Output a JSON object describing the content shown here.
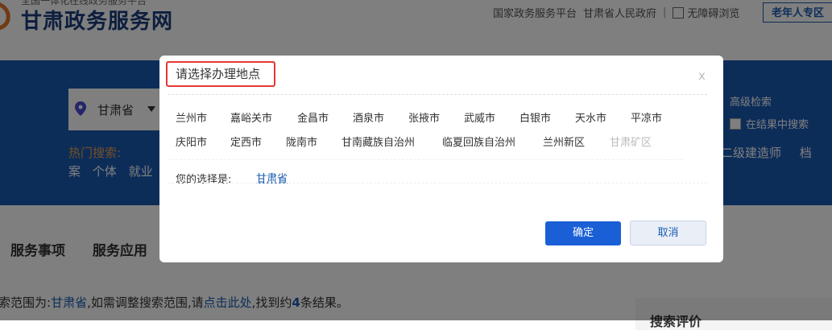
{
  "header": {
    "site_subtitle": "全国一体化在线政务服务平台",
    "site_title": "甘肃政务服务网",
    "links": [
      "国家政务服务平台",
      "甘肃省人民政府"
    ],
    "separator": "|",
    "accessibility": "无障碍浏览",
    "elder_zone": "老年人专区"
  },
  "banner": {
    "location": "甘肃省",
    "hot_label": "热门搜索:",
    "hot_row2": [
      "案",
      "个体",
      "就业"
    ],
    "advanced_search": "高级检索",
    "search_in_results": "在结果中搜索",
    "hot_right": [
      "二级建造师",
      "档"
    ]
  },
  "tabs": [
    "服务事项",
    "服务应用"
  ],
  "result": {
    "prefix": "索范围为:",
    "scope": "甘肃省",
    "middle": ",如需调整搜索范围,请",
    "link": "点击此处",
    "suffix1": ",找到约",
    "count": "4",
    "suffix2": "条结果。"
  },
  "side_panel": {
    "title": "搜索评价"
  },
  "modal": {
    "title": "请选择办理地点",
    "close": "x",
    "cities_row1": [
      "兰州市",
      "嘉峪关市",
      "金昌市",
      "酒泉市",
      "张掖市",
      "武威市",
      "白银市",
      "天水市",
      "平凉市"
    ],
    "cities_row2": [
      "庆阳市",
      "定西市",
      "陇南市",
      "甘南藏族自治州",
      "临夏回族自治州",
      "兰州新区"
    ],
    "disabled_city": "甘肃矿区",
    "choice_label": "您的选择是:",
    "choice_value": "甘肃省",
    "confirm": "确定",
    "cancel": "取消"
  },
  "colors": {
    "primary": "#1b5bb3",
    "accent_red": "#e53935",
    "hot_label": "#e8a14a",
    "confirm_button": "#1a5fd6"
  }
}
